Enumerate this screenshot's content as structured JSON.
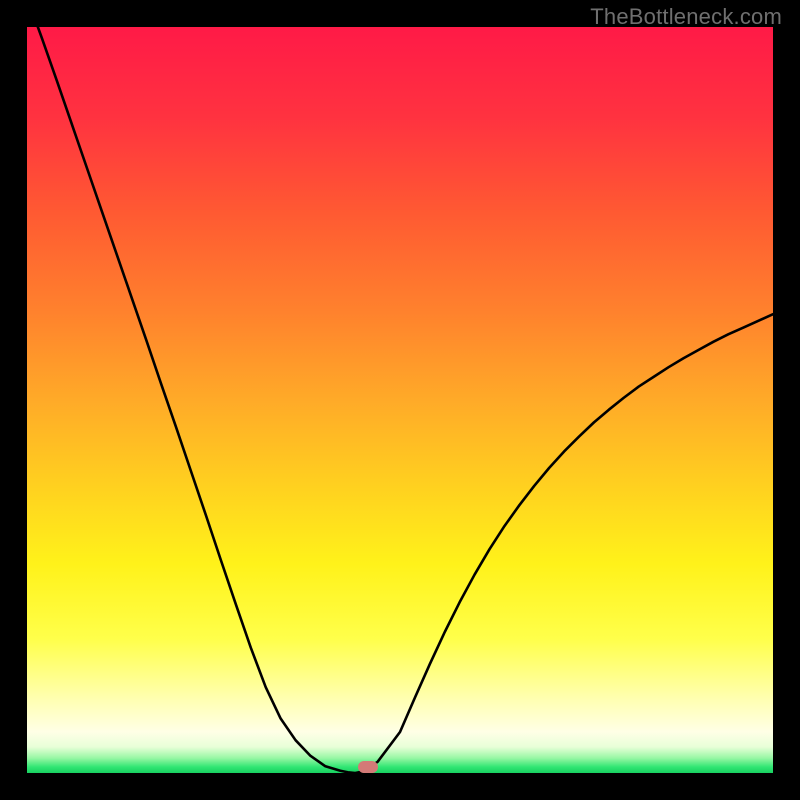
{
  "watermark": {
    "text": "TheBottleneck.com"
  },
  "plot": {
    "x_min": 0,
    "x_max": 746,
    "y_min": 0,
    "y_max": 746,
    "gradient_stops": [
      {
        "offset": 0.0,
        "color": "#ff1a47"
      },
      {
        "offset": 0.12,
        "color": "#ff3240"
      },
      {
        "offset": 0.25,
        "color": "#ff5a32"
      },
      {
        "offset": 0.38,
        "color": "#ff812d"
      },
      {
        "offset": 0.5,
        "color": "#ffaa28"
      },
      {
        "offset": 0.62,
        "color": "#ffd21f"
      },
      {
        "offset": 0.72,
        "color": "#fff21a"
      },
      {
        "offset": 0.82,
        "color": "#ffff4a"
      },
      {
        "offset": 0.9,
        "color": "#ffffb0"
      },
      {
        "offset": 0.945,
        "color": "#ffffe6"
      },
      {
        "offset": 0.965,
        "color": "#e8ffd8"
      },
      {
        "offset": 0.98,
        "color": "#97f7a4"
      },
      {
        "offset": 0.992,
        "color": "#30e673"
      },
      {
        "offset": 1.0,
        "color": "#18d060"
      }
    ],
    "marker": {
      "x_frac": 0.457,
      "y_frac": 0.992
    }
  },
  "chart_data": {
    "type": "line",
    "title": "",
    "xlabel": "",
    "ylabel": "",
    "x": [
      0.0,
      0.02,
      0.04,
      0.06,
      0.08,
      0.1,
      0.12,
      0.14,
      0.16,
      0.18,
      0.2,
      0.22,
      0.24,
      0.26,
      0.28,
      0.3,
      0.32,
      0.34,
      0.36,
      0.38,
      0.4,
      0.42,
      0.43,
      0.44,
      0.45,
      0.47,
      0.5,
      0.52,
      0.54,
      0.56,
      0.58,
      0.6,
      0.62,
      0.64,
      0.66,
      0.68,
      0.7,
      0.72,
      0.74,
      0.76,
      0.78,
      0.8,
      0.82,
      0.84,
      0.86,
      0.88,
      0.9,
      0.92,
      0.94,
      0.96,
      0.98,
      1.0
    ],
    "values": [
      1.04,
      0.985,
      0.928,
      0.87,
      0.812,
      0.754,
      0.696,
      0.638,
      0.58,
      0.521,
      0.463,
      0.404,
      0.345,
      0.285,
      0.226,
      0.168,
      0.115,
      0.073,
      0.044,
      0.023,
      0.009,
      0.003,
      0.001,
      0.0,
      0.002,
      0.015,
      0.055,
      0.101,
      0.146,
      0.189,
      0.229,
      0.266,
      0.3,
      0.331,
      0.359,
      0.385,
      0.409,
      0.431,
      0.451,
      0.47,
      0.487,
      0.503,
      0.518,
      0.531,
      0.544,
      0.556,
      0.567,
      0.578,
      0.588,
      0.597,
      0.606,
      0.615
    ],
    "xlim": [
      0,
      1
    ],
    "ylim": [
      0,
      1
    ],
    "notes": "y is bottleneck fraction (0 = ideal at valley floor near x≈0.45, 1 = top). Background gradient encodes same fraction via color from red (high) through yellow to green (low)."
  }
}
